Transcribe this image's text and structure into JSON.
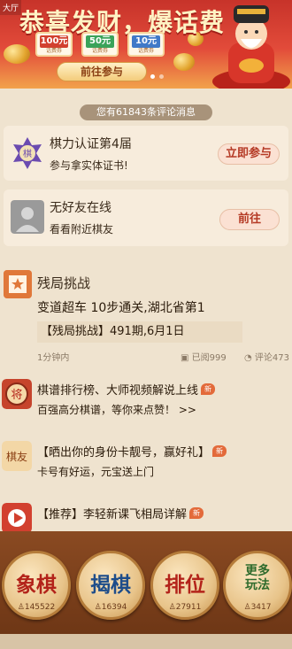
{
  "banner": {
    "tag": "大厅",
    "title": "恭喜发财，爆话费",
    "vouchers": [
      {
        "amount": "100元",
        "sub": "话费券"
      },
      {
        "amount": "50元",
        "sub": "话费券"
      },
      {
        "amount": "10元",
        "sub": "话费券"
      }
    ],
    "go_label": "前往参与"
  },
  "notice": "您有61843条评论消息",
  "cert_card": {
    "title": "棋力认证第4届",
    "subtitle": "参与拿实体证书!",
    "button": "立即参与"
  },
  "friend_card": {
    "title": "无好友在线",
    "subtitle": "看看附近棋友",
    "button": "前往"
  },
  "endgame": {
    "title": "残局挑战",
    "line": "变道超车 10步通关,湖北省第1",
    "box": "【残局挑战】491期,6月1日",
    "time": "1分钟内",
    "reads": "已阅999",
    "comments": "评论473"
  },
  "feed_items": [
    {
      "title": "棋谱排行榜、大师视频解说上线",
      "sub": "百强高分棋谱，等你来点赞！ >>",
      "new": "新"
    },
    {
      "title": "【晒出你的身份卡靓号，赢好礼】",
      "sub": "卡号有好运，元宝送上门",
      "new": "新"
    },
    {
      "title": "【推荐】李轻新课飞相局详解",
      "sub": "",
      "new": "新"
    }
  ],
  "games": [
    {
      "label": "象棋",
      "count": "145522"
    },
    {
      "label": "揭棋",
      "count": "16394"
    },
    {
      "label": "排位",
      "count": "27911"
    },
    {
      "label": "更多玩法",
      "count": "3417"
    }
  ]
}
